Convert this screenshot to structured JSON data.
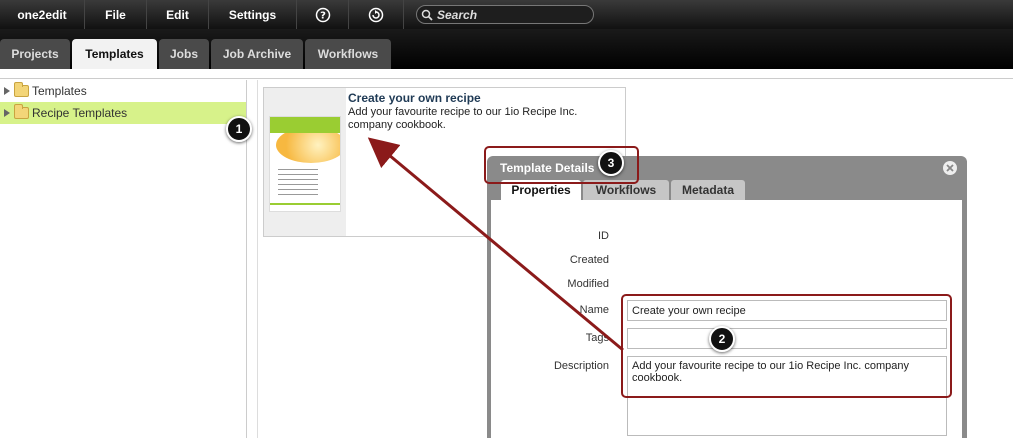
{
  "menubar": {
    "items": [
      "one2edit",
      "File",
      "Edit",
      "Settings"
    ],
    "search_placeholder": "Search"
  },
  "tabs": [
    "Projects",
    "Templates",
    "Jobs",
    "Job Archive",
    "Workflows"
  ],
  "active_tab": "Templates",
  "tree": {
    "items": [
      "Templates",
      "Recipe Templates"
    ],
    "selected": "Recipe Templates"
  },
  "template_card": {
    "title": "Create your own recipe",
    "description": "Add your favourite recipe to our 1io Recipe Inc. company cookbook."
  },
  "dialog": {
    "title": "Template Details",
    "tabs": [
      "Properties",
      "Workflows",
      "Metadata"
    ],
    "active_tab": "Properties",
    "labels": {
      "id": "ID",
      "created": "Created",
      "modified": "Modified",
      "name": "Name",
      "tags": "Tags",
      "description": "Description"
    },
    "values": {
      "name": "Create your own recipe",
      "tags": "",
      "description": "Add your favourite recipe to our 1io Recipe Inc. company cookbook."
    }
  },
  "annotations": [
    "1",
    "2",
    "3"
  ],
  "colors": {
    "selected_tree": "#d7f28a",
    "annotation_red": "#8b1a1a"
  }
}
